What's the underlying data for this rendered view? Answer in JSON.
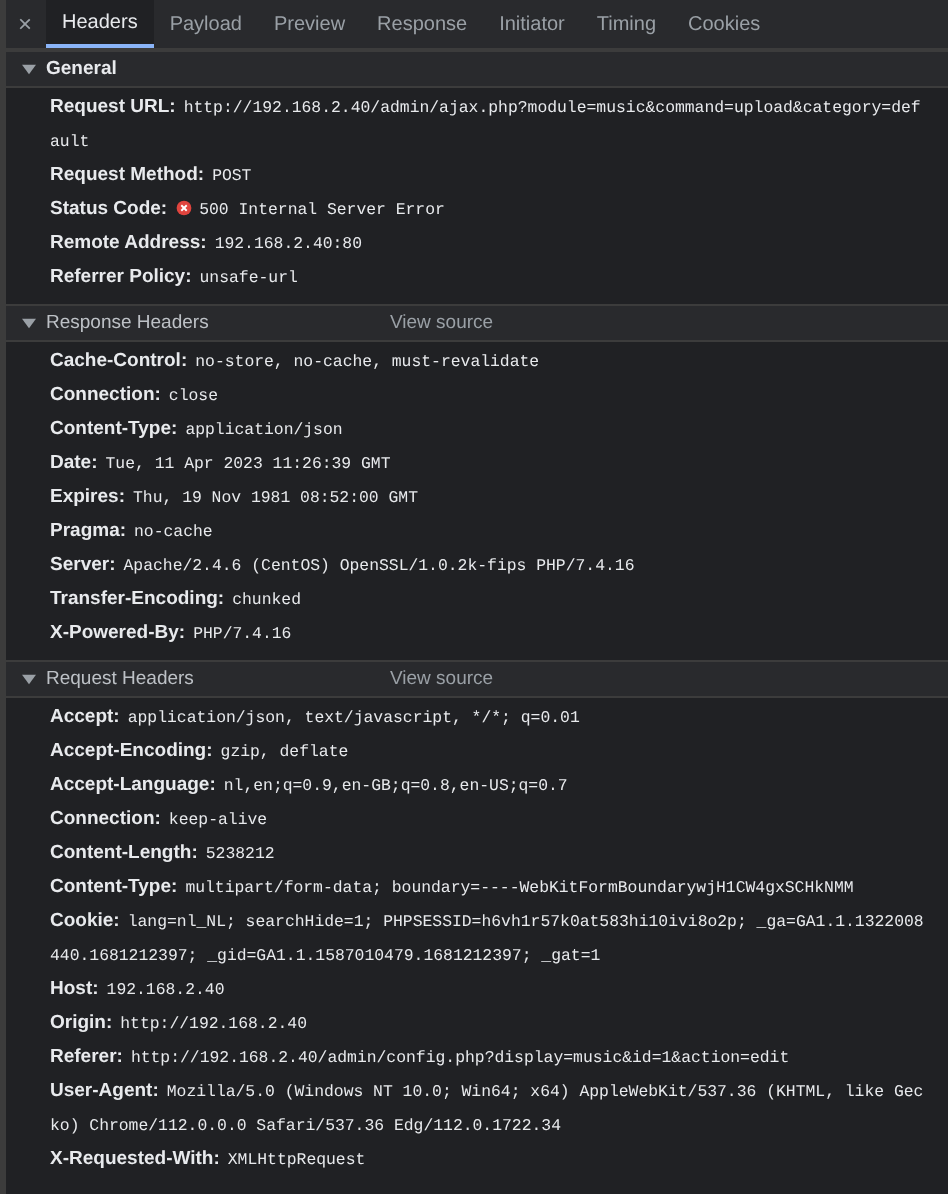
{
  "close": "×",
  "tabs": [
    {
      "label": "Headers",
      "selected": true
    },
    {
      "label": "Payload",
      "selected": false
    },
    {
      "label": "Preview",
      "selected": false
    },
    {
      "label": "Response",
      "selected": false
    },
    {
      "label": "Initiator",
      "selected": false
    },
    {
      "label": "Timing",
      "selected": false
    },
    {
      "label": "Cookies",
      "selected": false
    }
  ],
  "sections": [
    {
      "title": "General",
      "expanded": true,
      "rows": [
        {
          "name": "Request URL:",
          "value": "http://192.168.2.40/admin/ajax.php?module=music&command=upload&category=default"
        },
        {
          "name": "Request Method:",
          "value": "POST"
        },
        {
          "name": "Status Code:",
          "value": "500 Internal Server Error",
          "kind": "error"
        },
        {
          "name": "Remote Address:",
          "value": "192.168.2.40:80"
        },
        {
          "name": "Referrer Policy:",
          "value": "unsafe-url"
        }
      ]
    },
    {
      "title": "Response Headers",
      "expanded": true,
      "link": "View source",
      "rows": [
        {
          "name": "Cache-Control:",
          "value": "no-store, no-cache, must-revalidate"
        },
        {
          "name": "Connection:",
          "value": "close"
        },
        {
          "name": "Content-Type:",
          "value": "application/json"
        },
        {
          "name": "Date:",
          "value": "Tue, 11 Apr 2023 11:26:39 GMT"
        },
        {
          "name": "Expires:",
          "value": "Thu, 19 Nov 1981 08:52:00 GMT"
        },
        {
          "name": "Pragma:",
          "value": "no-cache"
        },
        {
          "name": "Server:",
          "value": "Apache/2.4.6 (CentOS) OpenSSL/1.0.2k-fips PHP/7.4.16"
        },
        {
          "name": "Transfer-Encoding:",
          "value": "chunked"
        },
        {
          "name": "X-Powered-By:",
          "value": "PHP/7.4.16"
        }
      ]
    },
    {
      "title": "Request Headers",
      "expanded": true,
      "link": "View source",
      "rows": [
        {
          "name": "Accept:",
          "value": "application/json, text/javascript, */*; q=0.01"
        },
        {
          "name": "Accept-Encoding:",
          "value": "gzip, deflate"
        },
        {
          "name": "Accept-Language:",
          "value": "nl,en;q=0.9,en-GB;q=0.8,en-US;q=0.7"
        },
        {
          "name": "Connection:",
          "value": "keep-alive"
        },
        {
          "name": "Content-Length:",
          "value": "5238212"
        },
        {
          "name": "Content-Type:",
          "value": "multipart/form-data; boundary=----WebKitFormBoundarywjH1CW4gxSCHkNMM"
        },
        {
          "name": "Cookie:",
          "value": "lang=nl_NL; searchHide=1; PHPSESSID=h6vh1r57k0at583hi10ivi8o2p; _ga=GA1.1.1322008440.1681212397; _gid=GA1.1.1587010479.1681212397; _gat=1"
        },
        {
          "name": "Host:",
          "value": "192.168.2.40"
        },
        {
          "name": "Origin:",
          "value": "http://192.168.2.40"
        },
        {
          "name": "Referer:",
          "value": "http://192.168.2.40/admin/config.php?display=music&id=1&action=edit"
        },
        {
          "name": "User-Agent:",
          "value": "Mozilla/5.0 (Windows NT 10.0; Win64; x64) AppleWebKit/537.36 (KHTML, like Gecko) Chrome/112.0.0.0 Safari/537.36 Edg/112.0.1722.34"
        },
        {
          "name": "X-Requested-With:",
          "value": "XMLHttpRequest"
        }
      ]
    }
  ]
}
